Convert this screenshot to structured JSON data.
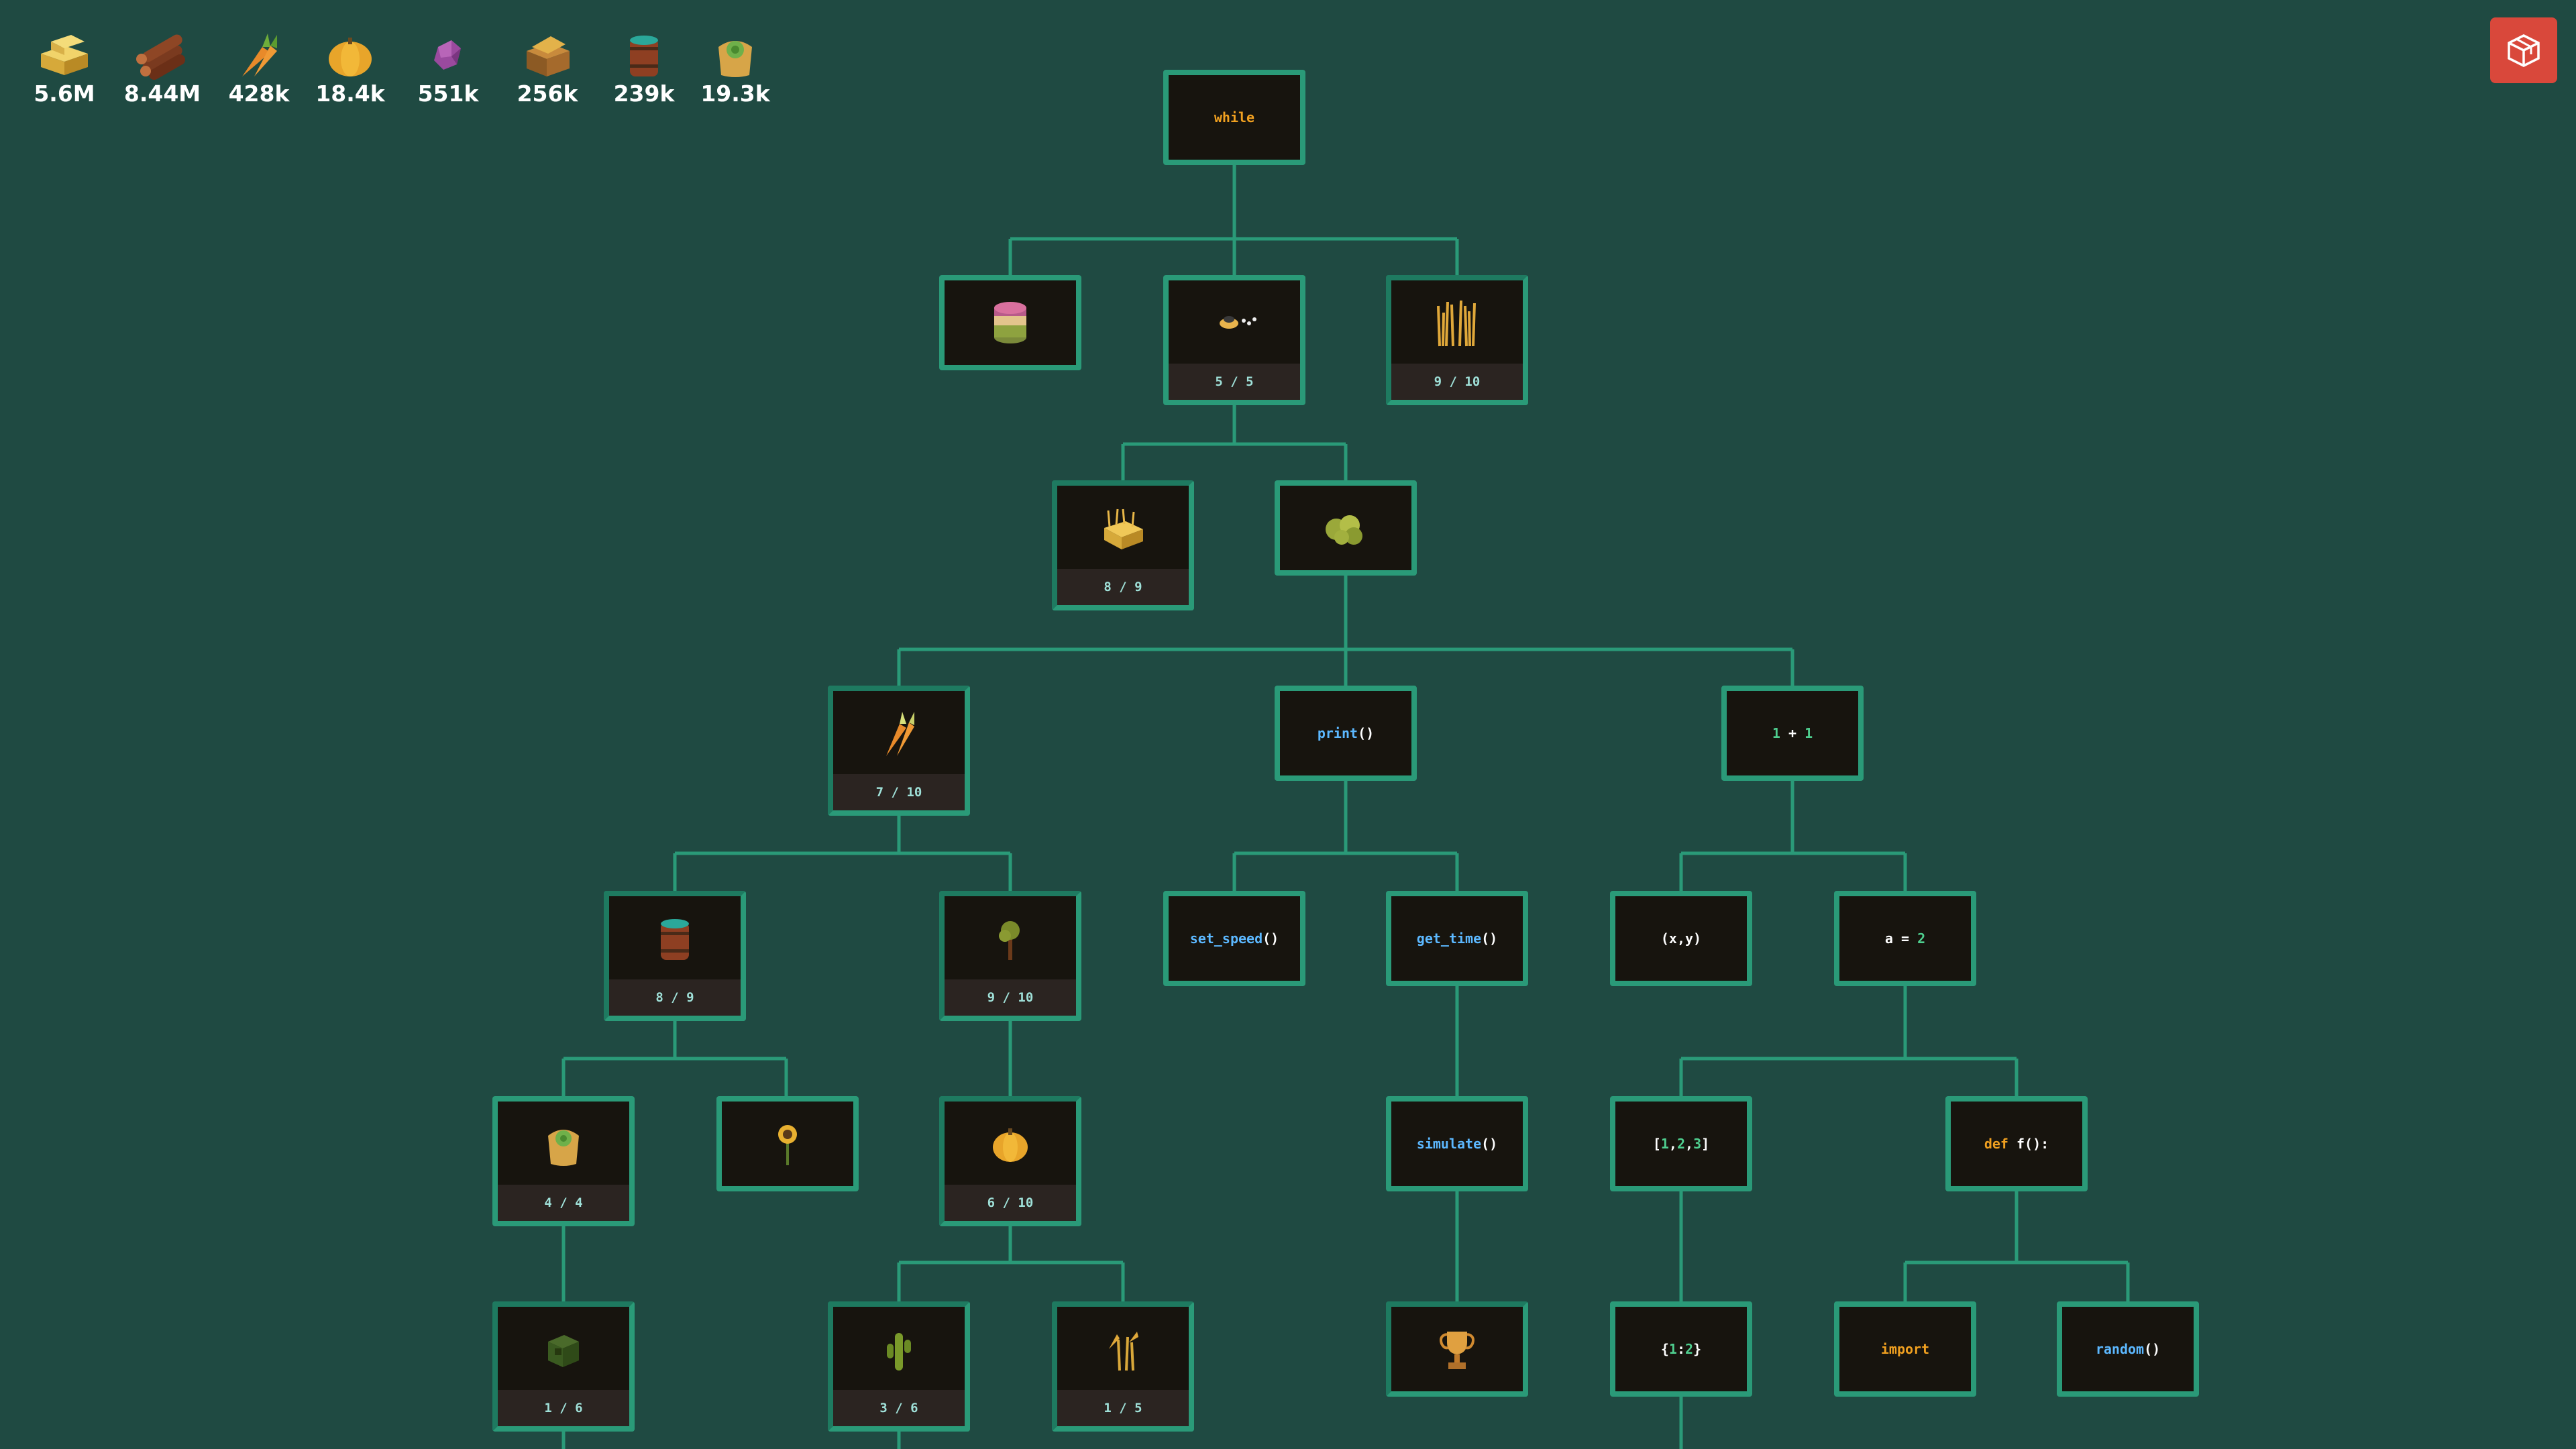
{
  "resources": [
    {
      "name": "hay",
      "icon": "hay-bale-icon",
      "value": "5.6M"
    },
    {
      "name": "wood",
      "icon": "wood-logs-icon",
      "value": "8.44M"
    },
    {
      "name": "carrot",
      "icon": "carrot-icon",
      "value": "428k"
    },
    {
      "name": "pumpkin",
      "icon": "pumpkin-icon",
      "value": "18.4k"
    },
    {
      "name": "power",
      "icon": "purple-crystal-icon",
      "value": "551k"
    },
    {
      "name": "gold",
      "icon": "treasure-chest-icon",
      "value": "256k"
    },
    {
      "name": "water",
      "icon": "water-barrel-icon",
      "value": "239k"
    },
    {
      "name": "fertilizer",
      "icon": "fertilizer-sack-icon",
      "value": "19.3k"
    }
  ],
  "nodes": {
    "while": {
      "kw": "while"
    },
    "print": {
      "fn": "print",
      "paren": "()"
    },
    "add": {
      "a": "1",
      "op": " + ",
      "b": "1"
    },
    "set_speed": {
      "fn": "set_speed",
      "paren": "()"
    },
    "get_time": {
      "fn": "get_time",
      "paren": "()"
    },
    "tuple": {
      "text": "(x,y)"
    },
    "assign": {
      "lhs": "a = ",
      "rhs": "2"
    },
    "simulate": {
      "fn": "simulate",
      "paren": "()"
    },
    "list": {
      "open": "[",
      "n1": "1",
      "c1": ",",
      "n2": "2",
      "c2": ",",
      "n3": "3",
      "close": "]"
    },
    "def": {
      "kw": "def ",
      "name": "f():"
    },
    "dict": {
      "open": "{",
      "n1": "1",
      "colon": ":",
      "n2": "2",
      "close": "}"
    },
    "import": {
      "kw": "import"
    },
    "random": {
      "fn": "random",
      "paren": "()"
    },
    "counts": {
      "speed": "5 / 5",
      "grass": "9 / 10",
      "hay": "8 / 9",
      "carrots": "7 / 10",
      "watering": "8 / 9",
      "trees": "9 / 10",
      "fertilizer": "4 / 4",
      "pumpkins": "6 / 10",
      "expand": "1 / 6",
      "cactus": "3 / 6",
      "polyculture": "1 / 5"
    }
  },
  "colors": {
    "background": "#1f4a42",
    "node_border": "#2a9a78",
    "node_fill": "#17140e",
    "keyword": "#f0a020",
    "function": "#5cb8ff",
    "number": "#4fcf8f",
    "menu_button": "#d9483b"
  },
  "menu_icon": "cube-outline-icon"
}
